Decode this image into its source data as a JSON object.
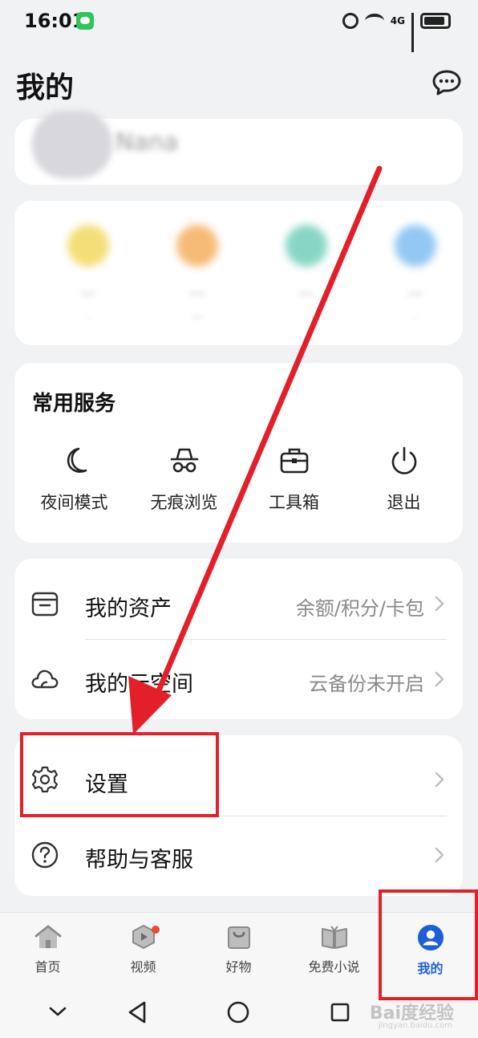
{
  "status_bar": {
    "time": "16:01",
    "network": "4G"
  },
  "header": {
    "title": "我的"
  },
  "services": {
    "title": "常用服务",
    "items": [
      {
        "label": "夜间模式",
        "icon": "moon-icon"
      },
      {
        "label": "无痕浏览",
        "icon": "incognito-icon"
      },
      {
        "label": "工具箱",
        "icon": "toolbox-icon"
      },
      {
        "label": "退出",
        "icon": "power-icon"
      }
    ]
  },
  "menu": {
    "assets": {
      "label": "我的资产",
      "value": "余额/积分/卡包"
    },
    "cloud": {
      "label": "我的云空间",
      "value": "云备份未开启"
    },
    "settings": {
      "label": "设置"
    },
    "help": {
      "label": "帮助与客服"
    }
  },
  "tabbar": {
    "items": [
      {
        "label": "首页",
        "icon": "home-icon"
      },
      {
        "label": "视频",
        "icon": "video-icon"
      },
      {
        "label": "好物",
        "icon": "shopping-bag-icon"
      },
      {
        "label": "免费小说",
        "icon": "book-icon"
      },
      {
        "label": "我的",
        "icon": "user-icon"
      }
    ],
    "active": "我的"
  },
  "watermark": {
    "text": "Bai度经验",
    "sub": "jingyan.baidu.com"
  },
  "colors": {
    "accent": "#1f5fd6",
    "annotation_red": "#e3202a",
    "badge_red": "#e84a2f"
  }
}
